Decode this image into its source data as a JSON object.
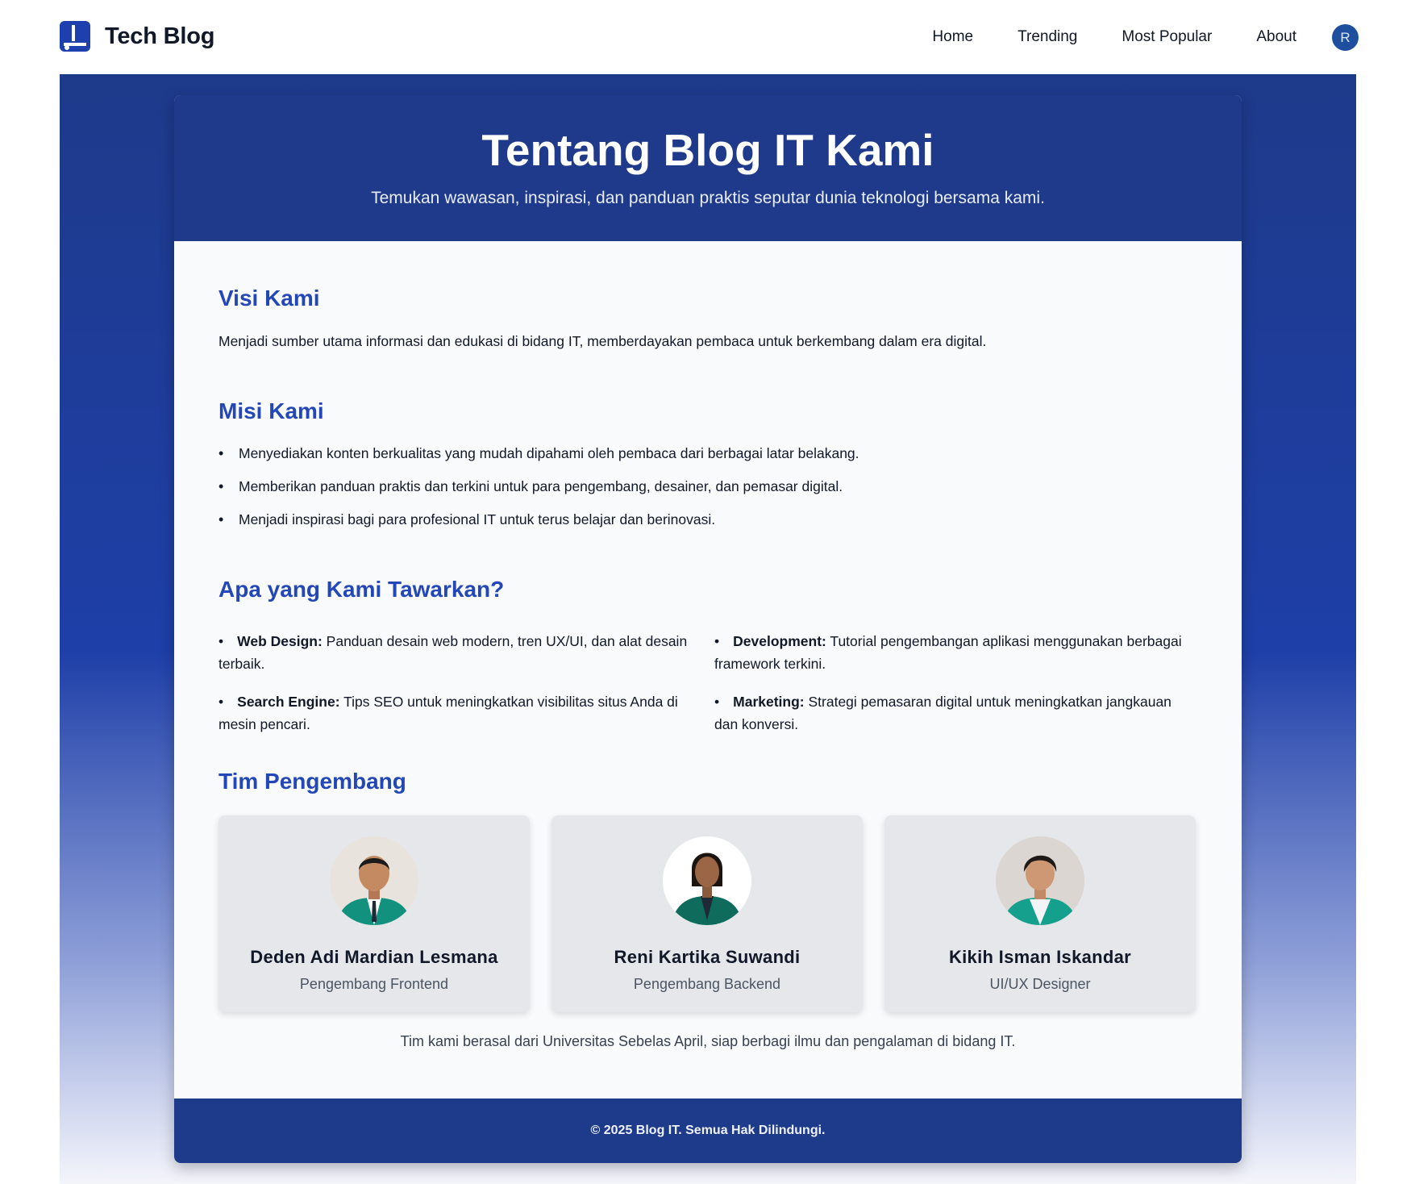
{
  "navbar": {
    "brand": "Tech Blog",
    "links": [
      "Home",
      "Trending",
      "Most Popular",
      "About"
    ],
    "avatar_initial": "R"
  },
  "hero": {
    "title": "Tentang Blog IT Kami",
    "subtitle": "Temukan wawasan, inspirasi, dan panduan praktis seputar dunia teknologi bersama kami."
  },
  "visi": {
    "title": "Visi Kami",
    "text": "Menjadi sumber utama informasi dan edukasi di bidang IT, memberdayakan pembaca untuk berkembang dalam era digital."
  },
  "misi": {
    "title": "Misi Kami",
    "items": [
      "Menyediakan konten berkualitas yang mudah dipahami oleh pembaca dari berbagai latar belakang.",
      "Memberikan panduan praktis dan terkini untuk para pengembang, desainer, dan pemasar digital.",
      "Menjadi inspirasi bagi para profesional IT untuk terus belajar dan berinovasi."
    ]
  },
  "offer": {
    "title": "Apa yang Kami Tawarkan?",
    "items": [
      {
        "label": "Web Design:",
        "text": " Panduan desain web modern, tren UX/UI, dan alat desain terbaik."
      },
      {
        "label": "Development:",
        "text": " Tutorial pengembangan aplikasi menggunakan berbagai framework terkini."
      },
      {
        "label": "Search Engine:",
        "text": " Tips SEO untuk meningkatkan visibilitas situs Anda di mesin pencari."
      },
      {
        "label": "Marketing:",
        "text": " Strategi pemasaran digital untuk meningkatkan jangkauan dan konversi."
      }
    ]
  },
  "team": {
    "title": "Tim Pengembang",
    "members": [
      {
        "name": "Deden Adi Mardian Lesmana",
        "role": "Pengembang Frontend"
      },
      {
        "name": "Reni Kartika Suwandi",
        "role": "Pengembang Backend"
      },
      {
        "name": "Kikih Isman Iskandar",
        "role": "UI/UX Designer"
      }
    ],
    "note": "Tim kami berasal dari Universitas Sebelas April, siap berbagi ilmu dan pengalaman di bidang IT."
  },
  "footer": {
    "text": "© 2025 Blog IT. Semua Hak Dilindungi."
  },
  "colors": {
    "primary": "#1e3a8a",
    "accent_heading": "#2447b8",
    "jacket": "#12917e"
  }
}
